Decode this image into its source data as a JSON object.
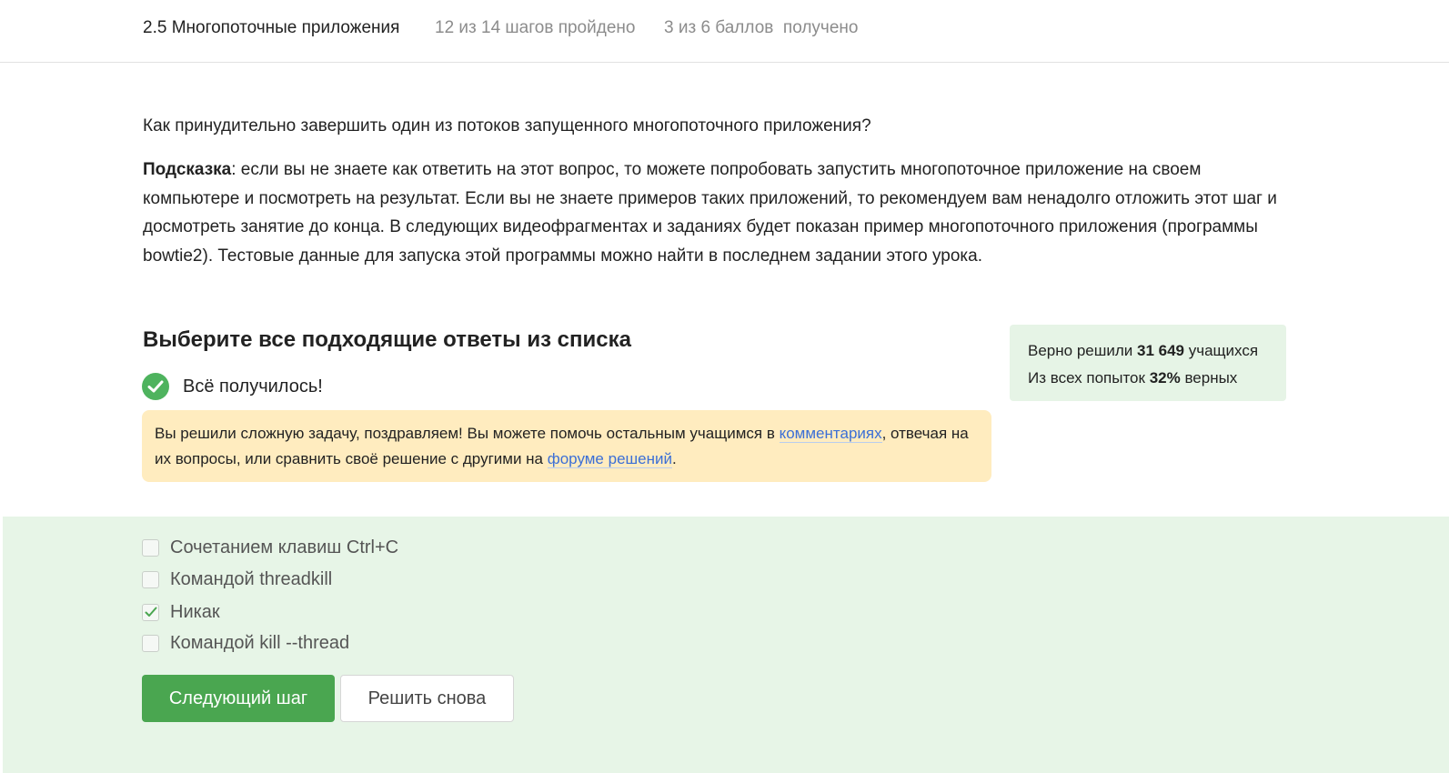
{
  "header": {
    "lesson_title": "2.5 Многопоточные приложения",
    "steps_progress": "12 из 14 шагов пройдено",
    "points_progress": "3 из 6 баллов  получено"
  },
  "step": {
    "question": "Как принудительно завершить один из потоков запущенного многопоточного приложения?",
    "hint_label": "Подсказка",
    "hint_text": ": если вы не знаете как ответить на этот вопрос, то можете попробовать запустить многопоточное приложение на своем компьютере и посмотреть на результат. Если вы не знаете примеров таких приложений, то рекомендуем вам ненадолго отложить этот шаг и досмотреть занятие до конца. В следующих видеофрагментах и заданиях будет показан пример многопоточного приложения (программы bowtie2). Тестовые данные для запуска этой программы можно найти в последнем задании этого урока."
  },
  "quiz": {
    "title": "Выберите все подходящие ответы из списка",
    "status_text": "Всё получилось!",
    "congrats": {
      "part1": "Вы решили сложную задачу, поздравляем! Вы можете помочь остальным учащимся в ",
      "link_comments": "комментариях",
      "part2": ", отвечая на их вопросы, или сравнить своё решение с другими на ",
      "link_forum": "форуме решений",
      "part3": "."
    },
    "options": [
      {
        "label": "Сочетанием клавиш Ctrl+C",
        "checked": false
      },
      {
        "label": "Командой threadkill",
        "checked": false
      },
      {
        "label": "Никак",
        "checked": true
      },
      {
        "label": "Командой kill --thread",
        "checked": false
      }
    ],
    "next_button": "Следующий шаг",
    "retry_button": "Решить снова"
  },
  "stats": {
    "solved_prefix": "Верно решили ",
    "solved_count": "31 649",
    "solved_suffix": " учащихся",
    "attempts_prefix": "Из всех попыток ",
    "attempts_percent": "32%",
    "attempts_suffix": " верных"
  },
  "colors": {
    "accent_green": "#4aa650",
    "success_icon": "#4eb35e",
    "answers_bg": "#e7f5e7",
    "congrats_bg": "#ffecbf",
    "link": "#3b6fd6"
  },
  "icons": {
    "success": "check-circle-icon",
    "checked": "checkmark-icon"
  }
}
